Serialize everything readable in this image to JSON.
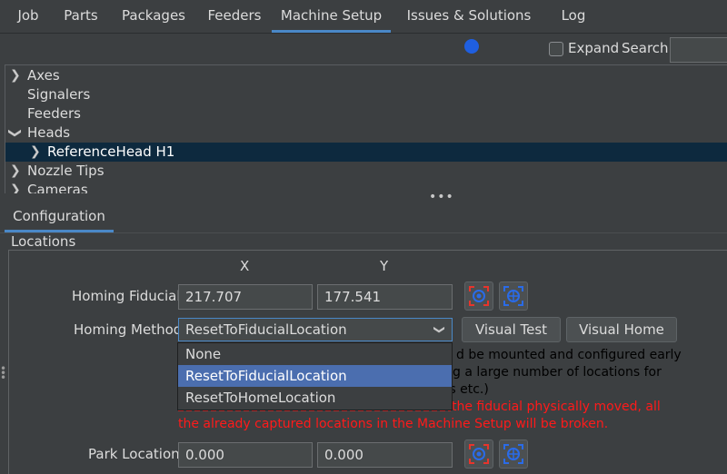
{
  "tabs": [
    {
      "label": "Job"
    },
    {
      "label": "Parts"
    },
    {
      "label": "Packages"
    },
    {
      "label": "Feeders"
    },
    {
      "label": "Machine Setup"
    },
    {
      "label": "Issues & Solutions"
    },
    {
      "label": "Log"
    }
  ],
  "active_tab": "Machine Setup",
  "toolbar": {
    "expand_label": "Expand",
    "search_label": "Search",
    "search_value": ""
  },
  "tree": {
    "items": [
      {
        "label": "Axes"
      },
      {
        "label": "Signalers"
      },
      {
        "label": "Feeders"
      },
      {
        "label": "Heads"
      },
      {
        "label": "ReferenceHead H1"
      },
      {
        "label": "Nozzle Tips"
      },
      {
        "label": "Cameras"
      }
    ]
  },
  "config": {
    "tab_label": "Configuration",
    "section_title": "Locations",
    "col_x": "X",
    "col_y": "Y",
    "homing_fiducial": {
      "label": "Homing Fiducial",
      "x": "217.707",
      "y": "177.541"
    },
    "homing_method": {
      "label": "Homing Method",
      "value": "ResetToFiducialLocation",
      "options": [
        "None",
        "ResetToFiducialLocation",
        "ResetToHomeLocation"
      ],
      "selected_index": 1
    },
    "visual_test_label": "Visual Test",
    "visual_home_label": "Visual Home",
    "info_black": [
      "d be mounted and configured early",
      "g a large number of locations for",
      "ers etc.)"
    ],
    "info_red": [
      "the fiducial physically moved, all",
      "the already captured locations in the Machine Setup will be broken."
    ],
    "park_location": {
      "label": "Park Location",
      "x": "0.000",
      "y": "0.000"
    }
  },
  "colors": {
    "accent": "#4a88c7",
    "selection": "#4b6eaf",
    "warning": "#ff1a1a",
    "badge": "#1f5fe0"
  }
}
